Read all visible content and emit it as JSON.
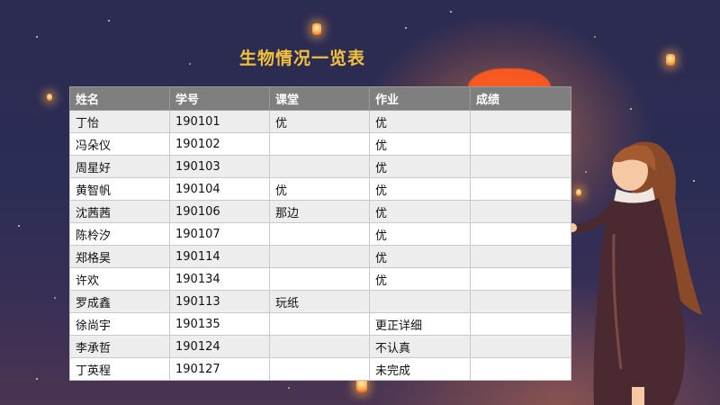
{
  "slide": {
    "title": "生物情况一览表"
  },
  "table": {
    "headers": [
      "姓名",
      "学号",
      "课堂",
      "作业",
      "成绩"
    ],
    "rows": [
      [
        "丁怡",
        "190101",
        "优",
        "优",
        ""
      ],
      [
        "冯朵仪",
        "190102",
        "",
        "优",
        ""
      ],
      [
        "周星好",
        "190103",
        "",
        "优",
        ""
      ],
      [
        "黄智帆",
        "190104",
        "优",
        "优",
        ""
      ],
      [
        "沈茜茜",
        "190106",
        "那边",
        "优",
        ""
      ],
      [
        "陈柃汐",
        "190107",
        "",
        "优",
        ""
      ],
      [
        "郑格昊",
        "190114",
        "",
        "优",
        ""
      ],
      [
        "许欢",
        "190134",
        "",
        "优",
        ""
      ],
      [
        "罗成鑫",
        "190113",
        "玩纸",
        "",
        ""
      ],
      [
        "徐尚宇",
        "190135",
        "",
        "更正详细",
        ""
      ],
      [
        "李承哲",
        "190124",
        "",
        "不认真",
        ""
      ],
      [
        "丁英程",
        "190127",
        "",
        "未完成",
        ""
      ]
    ]
  },
  "colors": {
    "title": "#f3c23c",
    "header_bg": "#7f7f7f",
    "sky": "#2c2b52",
    "sun": "#ff5a1f"
  },
  "icons": [
    "lantern-icon",
    "star-icon"
  ]
}
